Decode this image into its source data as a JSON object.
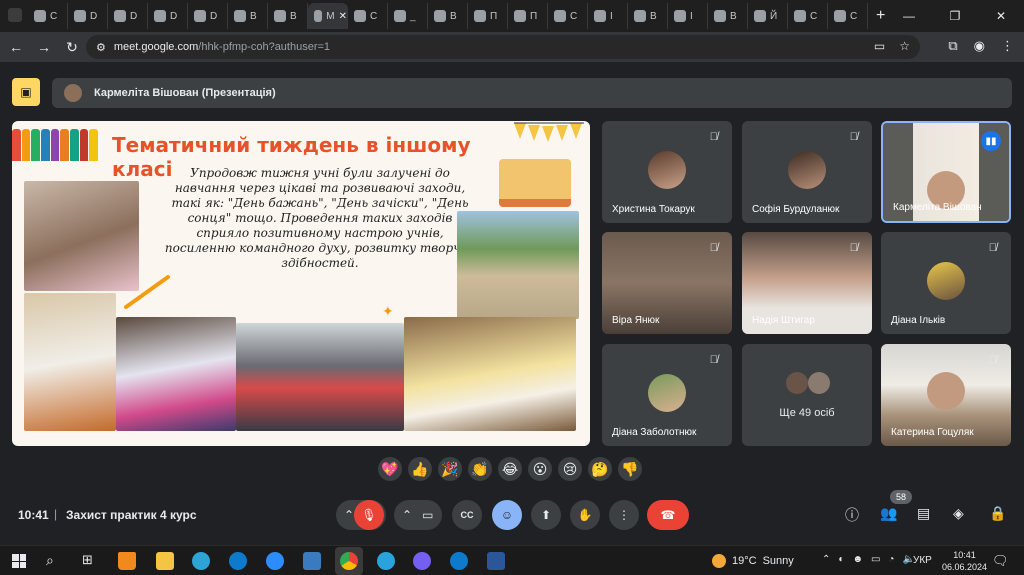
{
  "browser": {
    "tabs": [
      "С",
      "D",
      "D",
      "D",
      "D",
      "B",
      "B",
      "M",
      "С",
      "_",
      "B",
      "П",
      "П",
      "С",
      "І",
      "B",
      "І",
      "B",
      "Й",
      "С",
      "С"
    ],
    "url_host": "meet.google.com",
    "url_path": "/hhk-pfmp-coh?authuser=1"
  },
  "meet": {
    "presenter_banner": "Кармеліта Вішован (Презентація)",
    "time": "10:41",
    "separator": "|",
    "meeting_title": "Захист практик 4 курс",
    "participant_count": "58",
    "more_people": "Ще 49 осіб"
  },
  "slide": {
    "title": "Тематичний тиждень в іншому класі",
    "body": "Упродовж тижня учні були залучені до навчання через цікаві та розвиваючі заходи, такі як: \"День бажань\", \"День зачіски\", \"День сонця\" тощо. Проведення таких заходів сприяло позитивному настрою учнів, посиленню командного духу, розвитку творчих здібностей."
  },
  "participants": [
    {
      "name": "Христина Токарук"
    },
    {
      "name": "Софія Бурдуланюк"
    },
    {
      "name": "Кармеліта Вішован"
    },
    {
      "name": "Віра Янюк"
    },
    {
      "name": "Надія Штигар"
    },
    {
      "name": "Діана Ількiв"
    },
    {
      "name": "Діана Заболотнюк"
    },
    {
      "name": "Катерина Гоцуляк"
    }
  ],
  "reactions": [
    "💖",
    "👍",
    "🎉",
    "👏",
    "😂",
    "😮",
    "😢",
    "🤔",
    "👎"
  ],
  "taskbar": {
    "weather_temp": "19°C",
    "weather_text": "Sunny",
    "language": "УКР",
    "time": "10:41",
    "date": "06.06.2024"
  },
  "colors": {
    "accent": "#8ab4f8",
    "end_call": "#ea4335",
    "presenting": "#fdd663",
    "title_orange": "#e8522a"
  }
}
